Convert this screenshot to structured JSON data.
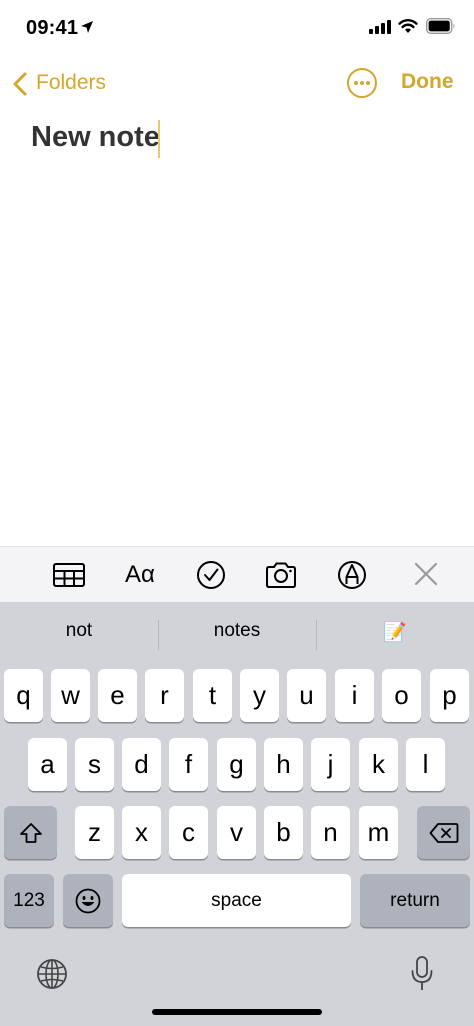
{
  "status_bar": {
    "time": "09:41"
  },
  "nav": {
    "back_label": "Folders",
    "done_label": "Done"
  },
  "note": {
    "title": "New note"
  },
  "toolbar": {
    "items": [
      "table-icon",
      "format-text-icon",
      "checklist-icon",
      "camera-icon",
      "markup-pen-icon",
      "close-icon"
    ],
    "format_label": "Aα"
  },
  "keyboard": {
    "suggestions": [
      "not",
      "notes",
      "📝"
    ],
    "rows": [
      [
        "q",
        "w",
        "e",
        "r",
        "t",
        "y",
        "u",
        "i",
        "o",
        "p"
      ],
      [
        "a",
        "s",
        "d",
        "f",
        "g",
        "h",
        "j",
        "k",
        "l"
      ],
      [
        "z",
        "x",
        "c",
        "v",
        "b",
        "n",
        "m"
      ]
    ],
    "numbers_label": "123",
    "space_label": "space",
    "return_label": "return"
  },
  "colors": {
    "accent": "#d4a72c",
    "keyboard_bg": "#d1d3d9",
    "key_bg": "#ffffff",
    "dark_key_bg": "#adb2bc"
  }
}
